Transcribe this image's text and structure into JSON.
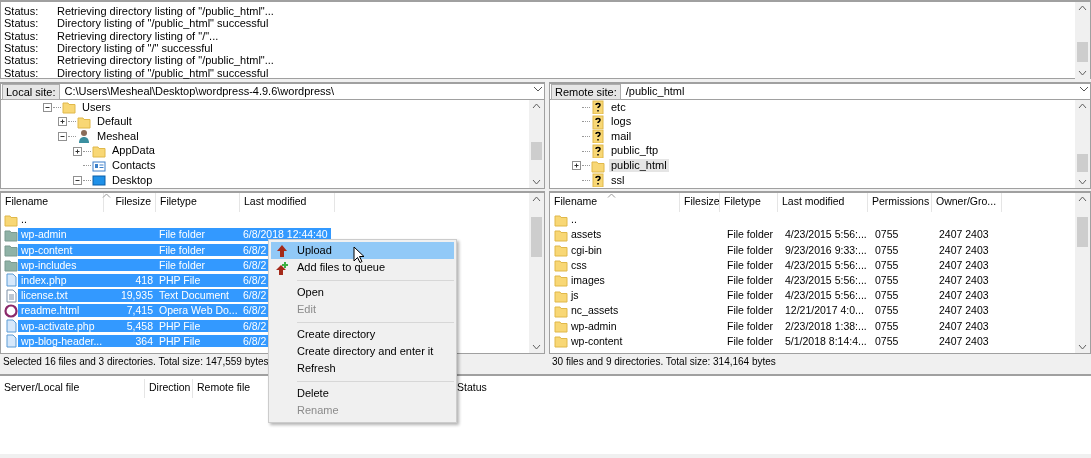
{
  "log": [
    {
      "label": "Status:",
      "message": "Retrieving directory listing of \"/public_html\"..."
    },
    {
      "label": "Status:",
      "message": "Directory listing of \"/public_html\" successful"
    },
    {
      "label": "Status:",
      "message": "Retrieving directory listing of \"/\"..."
    },
    {
      "label": "Status:",
      "message": "Directory listing of \"/\" successful"
    },
    {
      "label": "Status:",
      "message": "Retrieving directory listing of \"/public_html\"..."
    },
    {
      "label": "Status:",
      "message": "Directory listing of \"/public_html\" successful"
    }
  ],
  "local": {
    "site_label": "Local site:",
    "path": "C:\\Users\\Mesheal\\Desktop\\wordpress-4.9.6\\wordpress\\",
    "tree": [
      {
        "label": "Users",
        "kind": "folder",
        "expandable": true,
        "expanded": true,
        "children": [
          {
            "label": "Default",
            "kind": "folder",
            "expandable": true,
            "expanded": false
          },
          {
            "label": "Mesheal",
            "kind": "user",
            "expandable": true,
            "expanded": true,
            "children": [
              {
                "label": "AppData",
                "kind": "folder",
                "expandable": true,
                "expanded": false
              },
              {
                "label": "Contacts",
                "kind": "contacts",
                "expandable": false
              },
              {
                "label": "Desktop",
                "kind": "desktop",
                "expandable": true,
                "expanded": true
              }
            ]
          }
        ]
      }
    ],
    "columns": [
      "Filename",
      "Filesize",
      "Filetype",
      "Last modified"
    ],
    "files": [
      {
        "kind": "folder",
        "name": "..",
        "selected": false
      },
      {
        "kind": "folder",
        "name": "wp-admin",
        "type": "File folder",
        "modified": "6/8/2018 12:44:40",
        "selected": true
      },
      {
        "kind": "folder",
        "name": "wp-content",
        "type": "File folder",
        "modified": "6/8/2",
        "selected": true
      },
      {
        "kind": "folder",
        "name": "wp-includes",
        "type": "File folder",
        "modified": "6/8/2",
        "selected": true
      },
      {
        "kind": "file",
        "name": "index.php",
        "size": "418",
        "type": "PHP File",
        "modified": "6/8/2",
        "selected": true
      },
      {
        "kind": "text",
        "name": "license.txt",
        "size": "19,935",
        "type": "Text Document",
        "modified": "6/8/2",
        "selected": true
      },
      {
        "kind": "web",
        "name": "readme.html",
        "size": "7,415",
        "type": "Opera Web Do...",
        "modified": "6/8/2",
        "selected": true
      },
      {
        "kind": "file",
        "name": "wp-activate.php",
        "size": "5,458",
        "type": "PHP File",
        "modified": "6/8/2",
        "selected": true
      },
      {
        "kind": "file",
        "name": "wp-blog-header...",
        "size": "364",
        "type": "PHP File",
        "modified": "6/8/2",
        "selected": true
      }
    ],
    "status": "Selected 16 files and 3 directories. Total size: 147,559 bytes"
  },
  "remote": {
    "site_label": "Remote site:",
    "path": "/public_html",
    "tree": [
      {
        "label": "etc",
        "kind": "unknown",
        "expandable": false,
        "selected": false
      },
      {
        "label": "logs",
        "kind": "unknown",
        "expandable": false,
        "selected": false
      },
      {
        "label": "mail",
        "kind": "unknown",
        "expandable": false,
        "selected": false
      },
      {
        "label": "public_ftp",
        "kind": "unknown",
        "expandable": false,
        "selected": false
      },
      {
        "label": "public_html",
        "kind": "folder",
        "expandable": true,
        "expanded": false,
        "selected": true
      },
      {
        "label": "ssl",
        "kind": "unknown",
        "expandable": false,
        "selected": false
      }
    ],
    "columns": [
      "Filename",
      "Filesize",
      "Filetype",
      "Last modified",
      "Permissions",
      "Owner/Gro..."
    ],
    "files": [
      {
        "name": ".."
      },
      {
        "name": "assets",
        "type": "File folder",
        "modified": "4/23/2015 5:56:...",
        "permissions": "0755",
        "owner": "2407 2403"
      },
      {
        "name": "cgi-bin",
        "type": "File folder",
        "modified": "9/23/2016 9:33:...",
        "permissions": "0755",
        "owner": "2407 2403"
      },
      {
        "name": "css",
        "type": "File folder",
        "modified": "4/23/2015 5:56:...",
        "permissions": "0755",
        "owner": "2407 2403"
      },
      {
        "name": "images",
        "type": "File folder",
        "modified": "4/23/2015 5:56:...",
        "permissions": "0755",
        "owner": "2407 2403"
      },
      {
        "name": "js",
        "type": "File folder",
        "modified": "4/23/2015 5:56:...",
        "permissions": "0755",
        "owner": "2407 2403"
      },
      {
        "name": "nc_assets",
        "type": "File folder",
        "modified": "12/21/2017 4:0...",
        "permissions": "0755",
        "owner": "2407 2403"
      },
      {
        "name": "wp-admin",
        "type": "File folder",
        "modified": "2/23/2018 1:38:...",
        "permissions": "0755",
        "owner": "2407 2403"
      },
      {
        "name": "wp-content",
        "type": "File folder",
        "modified": "5/1/2018 8:14:4...",
        "permissions": "0755",
        "owner": "2407 2403"
      }
    ],
    "status": "30 files and 9 directories. Total size: 314,164 bytes"
  },
  "queue": {
    "columns": [
      "Server/Local file",
      "Direction",
      "Remote file",
      "Status"
    ]
  },
  "context_menu": [
    {
      "kind": "item",
      "label": "Upload",
      "disabled": false,
      "selected": true
    },
    {
      "kind": "item",
      "label": "Add files to queue",
      "disabled": false,
      "selected": false
    },
    {
      "kind": "separator"
    },
    {
      "kind": "item",
      "label": "Open",
      "disabled": false,
      "selected": false
    },
    {
      "kind": "item",
      "label": "Edit",
      "disabled": true,
      "selected": false
    },
    {
      "kind": "separator"
    },
    {
      "kind": "item",
      "label": "Create directory",
      "disabled": false,
      "selected": false
    },
    {
      "kind": "item",
      "label": "Create directory and enter it",
      "disabled": false,
      "selected": false
    },
    {
      "kind": "item",
      "label": "Refresh",
      "disabled": false,
      "selected": false
    },
    {
      "kind": "separator"
    },
    {
      "kind": "item",
      "label": "Delete",
      "disabled": false,
      "selected": false
    },
    {
      "kind": "item",
      "label": "Rename",
      "disabled": true,
      "selected": false
    }
  ]
}
